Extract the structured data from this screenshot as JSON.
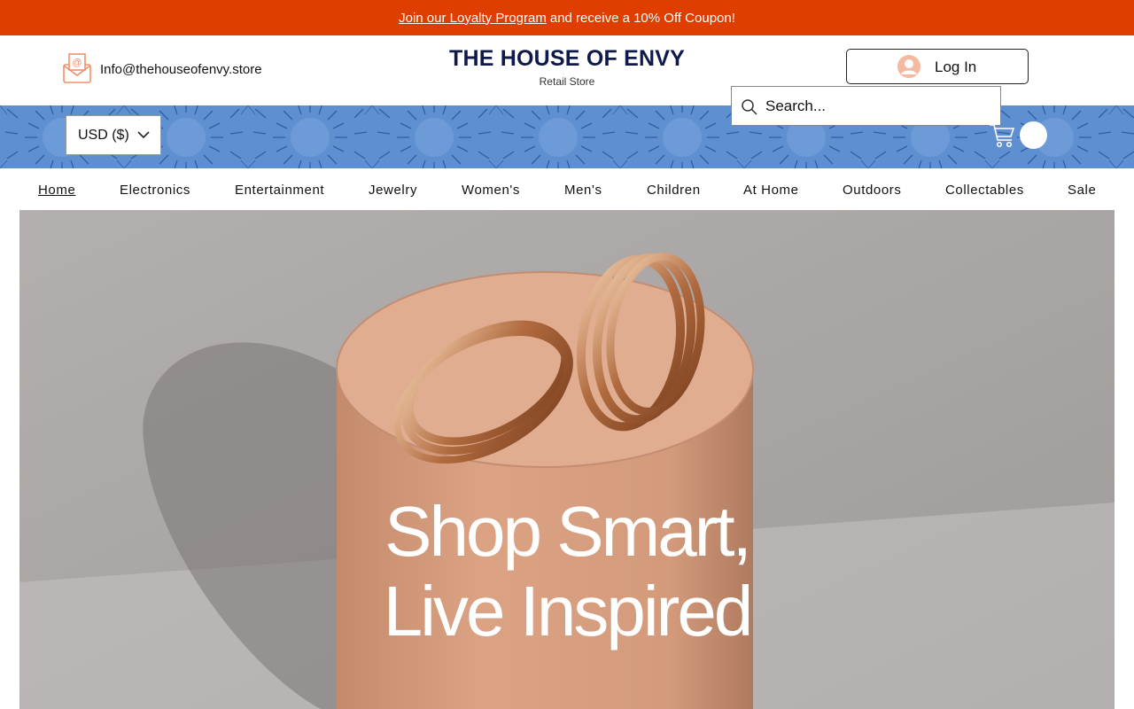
{
  "promo": {
    "link_text": "Join our Loyalty Program",
    "rest_text": "and receive a 10% Off Coupon!"
  },
  "header": {
    "email": "Info@thehouseofenvy.store",
    "brand": "THE HOUSE OF ENVY",
    "tagline": "Retail Store",
    "login_label": "Log In"
  },
  "currency": {
    "selected": "USD ($)"
  },
  "search": {
    "placeholder": "Search..."
  },
  "nav": {
    "items": [
      {
        "label": "Home",
        "active": true
      },
      {
        "label": "Electronics"
      },
      {
        "label": "Entertainment"
      },
      {
        "label": "Jewelry"
      },
      {
        "label": "Women's"
      },
      {
        "label": "Men's"
      },
      {
        "label": "Children"
      },
      {
        "label": "At Home"
      },
      {
        "label": "Outdoors"
      },
      {
        "label": "Collectables"
      },
      {
        "label": "Sale"
      }
    ]
  },
  "hero": {
    "line1": "Shop Smart,",
    "line2": "Live Inspired"
  },
  "colors": {
    "promo_bg": "#e03d00",
    "brand_navy": "#0f1a4a",
    "banner_blue": "#5e8fd0",
    "accent_orange": "#f0906a"
  },
  "icons": [
    "email-icon",
    "avatar-icon",
    "chevron-down-icon",
    "search-icon",
    "cart-icon"
  ]
}
